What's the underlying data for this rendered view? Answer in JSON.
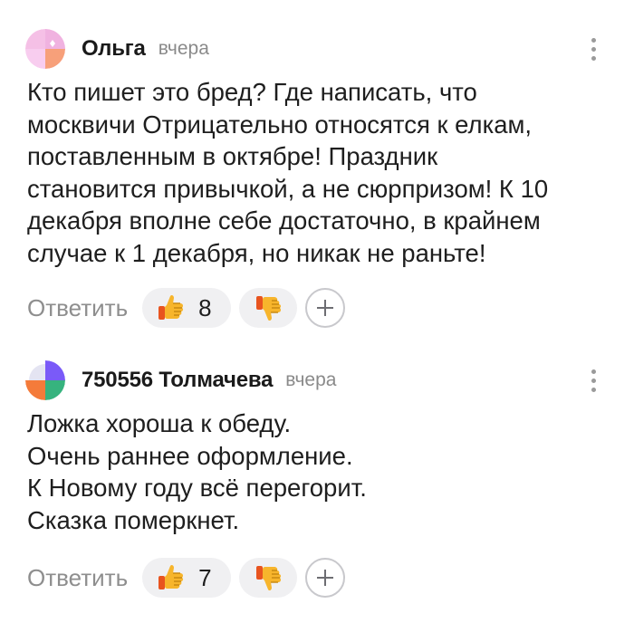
{
  "comments": [
    {
      "author": "Ольга",
      "time": "вчера",
      "avatar_icon": "avatar-icon",
      "avatar_colors": [
        "#f5c0e6",
        "#f7a07a",
        "#ffffff"
      ],
      "lines": [
        "Кто пишет это бред? Где написать, что",
        "москвичи Отрицательно относятся к елкам,",
        "поставленным в октябре! Праздник",
        "становится привычкой, а не сюрпризом! К 10",
        "декабря вполне себе достаточно, в крайнем",
        "случае к 1 декабря, но никак не раньте!"
      ],
      "reply_label": "Ответить",
      "likes": "8"
    },
    {
      "author": "750556 Толмачева",
      "time": "вчера",
      "avatar_icon": "avatar-icon",
      "avatar_colors": [
        "#7a5af8",
        "#f47b3a",
        "#36b37e",
        "#ffffff"
      ],
      "lines": [
        "Ложка хороша к обеду.",
        "Очень раннее оформление.",
        "К Новому году всё перегорит.",
        "Сказка померкнет."
      ],
      "reply_label": "Ответить",
      "likes": "7"
    }
  ],
  "icons": {
    "menu": "more-vertical-icon",
    "like": "thumbs-up-emoji-icon",
    "dislike": "thumbs-down-emoji-icon",
    "add": "plus-icon"
  },
  "colors": {
    "author": "#1a1a1a",
    "time": "#8a8a8a",
    "reply": "#8e8e8e",
    "pill_bg": "#f0f0f2",
    "emoji": "#f7b52c"
  }
}
